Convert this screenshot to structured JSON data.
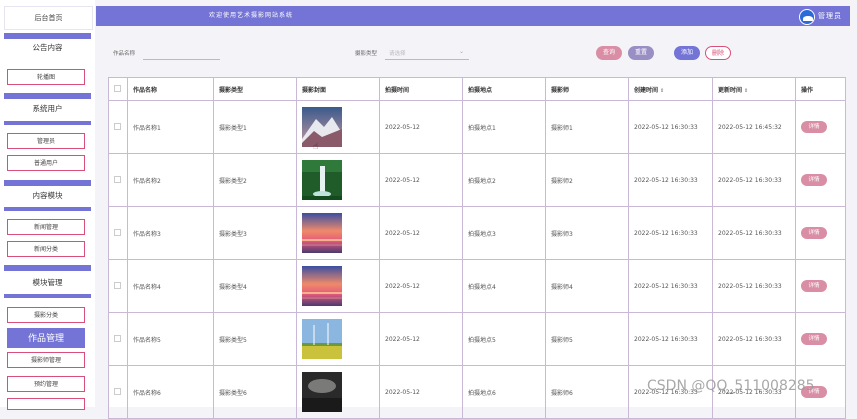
{
  "header": {
    "title": "欢迎使用艺术摄影网站系统",
    "admin_label": "管理员",
    "admin_icon": "admin-avatar-icon"
  },
  "sidebar": {
    "home": "后台首页",
    "groups": [
      {
        "label": "公告内容",
        "items": [
          "轮播图"
        ]
      },
      {
        "label": "系统用户",
        "items": [
          "管理员",
          "普通用户"
        ]
      },
      {
        "label": "内容模块",
        "items": [
          "新闻管理",
          "新闻分类"
        ]
      },
      {
        "label": "模块管理",
        "items": [
          "摄影分类",
          "作品管理",
          "摄影师管理",
          "预约管理"
        ]
      }
    ],
    "active_item": "作品管理"
  },
  "search": {
    "name_label": "作品名称",
    "type_label": "摄影类型",
    "type_placeholder": "请选择",
    "query_label": "查询",
    "reset_label": "重置",
    "add_label": "添加",
    "delete_label": "删除"
  },
  "table": {
    "headers": [
      "作品名称",
      "摄影类型",
      "摄影封面",
      "拍摄时间",
      "拍摄地点",
      "摄影师",
      "创建时间",
      "更新时间",
      "操作"
    ],
    "sortable": [
      "创建时间",
      "更新时间"
    ],
    "rows": [
      {
        "name": "作品名称1",
        "type": "摄影类型1",
        "cover": "mountain",
        "date": "2022-05-12",
        "place": "拍摄地点1",
        "photographer": "摄影师1",
        "created": "2022-05-12 16:30:33",
        "updated": "2022-05-12 16:45:32",
        "action": "详情"
      },
      {
        "name": "作品名称2",
        "type": "摄影类型2",
        "cover": "waterfall",
        "date": "2022-05-12",
        "place": "拍摄地点2",
        "photographer": "摄影师2",
        "created": "2022-05-12 16:30:33",
        "updated": "2022-05-12 16:30:33",
        "action": "详情"
      },
      {
        "name": "作品名称3",
        "type": "摄影类型3",
        "cover": "sunset",
        "date": "2022-05-12",
        "place": "拍摄地点3",
        "photographer": "摄影师3",
        "created": "2022-05-12 16:30:33",
        "updated": "2022-05-12 16:30:33",
        "action": "详情"
      },
      {
        "name": "作品名称4",
        "type": "摄影类型4",
        "cover": "sunset",
        "date": "2022-05-12",
        "place": "拍摄地点4",
        "photographer": "摄影师4",
        "created": "2022-05-12 16:30:33",
        "updated": "2022-05-12 16:30:33",
        "action": "详情"
      },
      {
        "name": "作品名称5",
        "type": "摄影类型5",
        "cover": "field",
        "date": "2022-05-12",
        "place": "拍摄地点5",
        "photographer": "摄影师5",
        "created": "2022-05-12 16:30:33",
        "updated": "2022-05-12 16:30:33",
        "action": "详情"
      },
      {
        "name": "作品名称6",
        "type": "摄影类型6",
        "cover": "dark",
        "date": "2022-05-12",
        "place": "拍摄地点6",
        "photographer": "摄影师6",
        "created": "2022-05-12 16:30:33",
        "updated": "2022-05-12 16:30:33",
        "action": "详情"
      }
    ]
  },
  "watermark": "CSDN @QQ_511008285",
  "colors": {
    "accent": "#7374d6",
    "pink": "#d98ea6",
    "danger": "#d84f7a"
  }
}
